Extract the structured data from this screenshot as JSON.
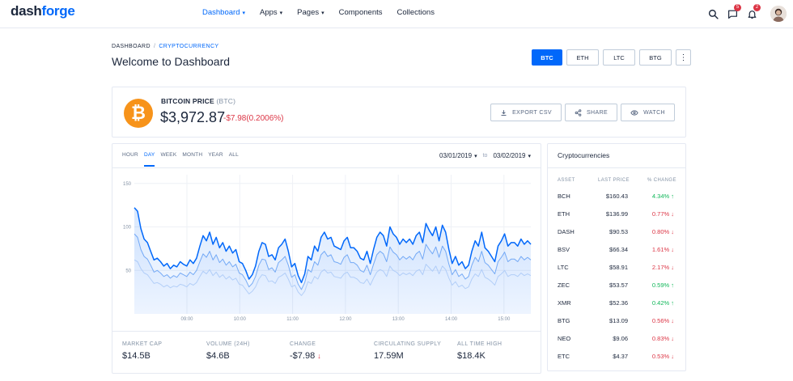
{
  "brand": {
    "part1": "dash",
    "part2": "forge"
  },
  "nav": [
    {
      "label": "Dashboard",
      "active": true,
      "caret": true
    },
    {
      "label": "Apps",
      "active": false,
      "caret": true
    },
    {
      "label": "Pages",
      "active": false,
      "caret": true
    },
    {
      "label": "Components",
      "active": false,
      "caret": false
    },
    {
      "label": "Collections",
      "active": false,
      "caret": false
    }
  ],
  "top_icons": {
    "search": "search-icon",
    "messages": {
      "icon": "message-icon",
      "badge": "5"
    },
    "notifications": {
      "icon": "bell-icon",
      "badge": "2"
    }
  },
  "breadcrumb": {
    "root": "DASHBOARD",
    "current": "CRYPTOCURRENCY"
  },
  "page_title": "Welcome to Dashboard",
  "coin_tabs": [
    {
      "label": "BTC",
      "active": true
    },
    {
      "label": "ETH",
      "active": false
    },
    {
      "label": "LTC",
      "active": false
    },
    {
      "label": "BTG",
      "active": false
    }
  ],
  "price": {
    "label": "BITCOIN PRICE",
    "symbol": "(BTC)",
    "value": "$3,972.87",
    "change": "-$7.98(0.2006%)"
  },
  "actions": {
    "export": "EXPORT CSV",
    "share": "SHARE",
    "watch": "WATCH"
  },
  "range_tabs": [
    {
      "label": "HOUR",
      "active": false
    },
    {
      "label": "DAY",
      "active": true
    },
    {
      "label": "WEEK",
      "active": false
    },
    {
      "label": "MONTH",
      "active": false
    },
    {
      "label": "YEAR",
      "active": false
    },
    {
      "label": "ALL",
      "active": false
    }
  ],
  "date_range": {
    "from": "03/01/2019",
    "to_label": "to",
    "to": "03/02/2019"
  },
  "chart_data": {
    "type": "area",
    "x_ticks": [
      "09:00",
      "10:00",
      "11:00",
      "12:00",
      "13:00",
      "14:00",
      "15:00"
    ],
    "y_ticks": [
      50,
      100,
      150
    ],
    "ylim": [
      0,
      160
    ],
    "grid": true,
    "series": [
      {
        "color": "#0168fa",
        "values": [
          122,
          118,
          98,
          86,
          82,
          72,
          62,
          64,
          60,
          55,
          58,
          52,
          56,
          54,
          60,
          57,
          55,
          62,
          58,
          64,
          78,
          90,
          84,
          94,
          80,
          88,
          76,
          82,
          72,
          78,
          70,
          74,
          60,
          58,
          50,
          40,
          45,
          55,
          72,
          82,
          80,
          66,
          68,
          62,
          76,
          80,
          86,
          72,
          54,
          58,
          44,
          36,
          46,
          66,
          62,
          78,
          72,
          88,
          94,
          86,
          88,
          78,
          76,
          74,
          84,
          88,
          76,
          76,
          72,
          64,
          62,
          72,
          58,
          74,
          88,
          94,
          90,
          78,
          100,
          92,
          88,
          80,
          86,
          82,
          86,
          80,
          90,
          94,
          82,
          104,
          96,
          90,
          100,
          84,
          102,
          94,
          74,
          58,
          66,
          56,
          60,
          52,
          56,
          72,
          84,
          78,
          94,
          76,
          72,
          66,
          60,
          78,
          84,
          92,
          78,
          82,
          82,
          78,
          86,
          80,
          84,
          80
        ]
      },
      {
        "color": "#7fb0f5",
        "values": [
          92,
          88,
          74,
          66,
          63,
          56,
          48,
          50,
          47,
          43,
          45,
          41,
          44,
          42,
          47,
          45,
          43,
          48,
          45,
          50,
          60,
          69,
          65,
          72,
          62,
          68,
          59,
          63,
          56,
          60,
          54,
          57,
          47,
          45,
          39,
          31,
          35,
          43,
          56,
          63,
          62,
          51,
          53,
          48,
          59,
          62,
          66,
          56,
          42,
          45,
          34,
          28,
          36,
          51,
          48,
          60,
          56,
          68,
          72,
          66,
          68,
          60,
          59,
          57,
          65,
          68,
          59,
          59,
          56,
          50,
          48,
          56,
          45,
          57,
          68,
          72,
          69,
          60,
          77,
          71,
          68,
          62,
          66,
          63,
          66,
          62,
          69,
          72,
          63,
          80,
          74,
          69,
          77,
          65,
          78,
          72,
          57,
          45,
          51,
          43,
          46,
          40,
          43,
          56,
          65,
          60,
          72,
          59,
          56,
          51,
          46,
          60,
          65,
          71,
          60,
          63,
          63,
          60,
          66,
          62,
          65,
          62
        ]
      },
      {
        "color": "#c9dcf8",
        "values": [
          62,
          60,
          52,
          47,
          45,
          40,
          35,
          36,
          34,
          31,
          33,
          30,
          32,
          31,
          34,
          33,
          31,
          35,
          33,
          36,
          43,
          49,
          46,
          51,
          44,
          48,
          42,
          45,
          40,
          43,
          39,
          41,
          34,
          33,
          28,
          23,
          26,
          31,
          40,
          45,
          44,
          37,
          38,
          35,
          42,
          44,
          47,
          40,
          31,
          33,
          25,
          21,
          26,
          37,
          35,
          43,
          40,
          48,
          51,
          47,
          48,
          43,
          42,
          41,
          46,
          48,
          42,
          42,
          40,
          36,
          35,
          40,
          33,
          41,
          48,
          51,
          49,
          43,
          55,
          50,
          48,
          44,
          47,
          45,
          47,
          44,
          49,
          51,
          45,
          57,
          53,
          49,
          55,
          46,
          55,
          51,
          41,
          33,
          37,
          31,
          33,
          29,
          31,
          40,
          46,
          43,
          51,
          42,
          40,
          37,
          33,
          43,
          46,
          50,
          43,
          45,
          45,
          43,
          47,
          44,
          46,
          44
        ]
      }
    ]
  },
  "stats": [
    {
      "label": "MARKET CAP",
      "value": "$14.5B",
      "down": ""
    },
    {
      "label": "VOLUME (24H)",
      "value": "$4.6B",
      "down": ""
    },
    {
      "label": "CHANGE",
      "value": "-$7.98",
      "down": "↓"
    },
    {
      "label": "CIRCULATING SUPPLY",
      "value": "17.59M",
      "down": ""
    },
    {
      "label": "ALL TIME HIGH",
      "value": "$18.4K",
      "down": ""
    }
  ],
  "crypto": {
    "title": "Cryptocurrencies",
    "headers": {
      "asset": "ASSET",
      "price": "LAST PRICE",
      "change": "% CHANGE"
    },
    "rows": [
      {
        "asset": "BCH",
        "price": "$160.43",
        "change": "4.34%",
        "dir": "up"
      },
      {
        "asset": "ETH",
        "price": "$136.99",
        "change": "0.77%",
        "dir": "down"
      },
      {
        "asset": "DASH",
        "price": "$90.53",
        "change": "0.80%",
        "dir": "down"
      },
      {
        "asset": "BSV",
        "price": "$66.34",
        "change": "1.61%",
        "dir": "down"
      },
      {
        "asset": "LTC",
        "price": "$58.91",
        "change": "2.17%",
        "dir": "down"
      },
      {
        "asset": "ZEC",
        "price": "$53.57",
        "change": "0.59%",
        "dir": "up"
      },
      {
        "asset": "XMR",
        "price": "$52.36",
        "change": "0.42%",
        "dir": "up"
      },
      {
        "asset": "BTG",
        "price": "$13.09",
        "change": "0.56%",
        "dir": "down"
      },
      {
        "asset": "NEO",
        "price": "$9.06",
        "change": "0.83%",
        "dir": "down"
      },
      {
        "asset": "ETC",
        "price": "$4.37",
        "change": "0.53%",
        "dir": "down"
      }
    ]
  }
}
